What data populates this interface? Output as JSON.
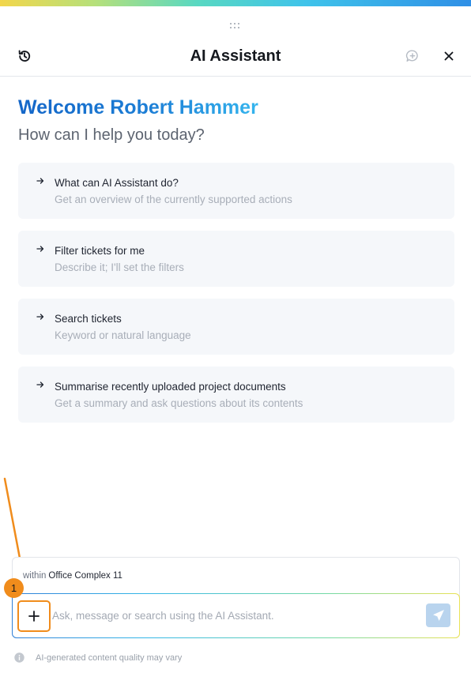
{
  "header": {
    "title": "AI Assistant"
  },
  "welcome": {
    "heading": "Welcome Robert Hammer",
    "subheading": "How can I help you today?"
  },
  "suggestions": [
    {
      "title": "What can AI Assistant do?",
      "description": "Get an overview of the currently supported actions"
    },
    {
      "title": "Filter tickets for me",
      "description": "Describe it; I'll set the filters"
    },
    {
      "title": "Search tickets",
      "description": "Keyword or natural language"
    },
    {
      "title": "Summarise recently uploaded project documents",
      "description": "Get a summary and ask questions about its contents"
    }
  ],
  "composer": {
    "context_prefix": "within",
    "context_value": "Office Complex 11",
    "placeholder": "Ask, message or search using the AI Assistant.",
    "value": ""
  },
  "annotation": {
    "badge_number": "1",
    "color": "#f08c1c"
  },
  "footer": {
    "note": "AI-generated content quality may vary"
  },
  "icons": {
    "history": "history-icon",
    "new_chat": "new-chat-icon",
    "close": "close-icon",
    "drag": "drag-handle-icon",
    "arrow": "arrow-right-icon",
    "add": "plus-icon",
    "send": "send-icon",
    "info": "info-icon"
  },
  "colors": {
    "brand_blue": "#1466c8",
    "accent_light_blue": "#35b5ee",
    "card_background": "#f5f7fa",
    "send_button": "#b9d4ee"
  }
}
